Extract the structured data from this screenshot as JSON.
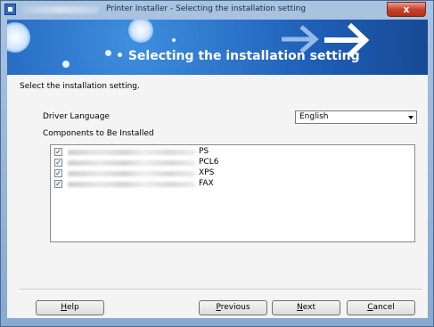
{
  "window": {
    "title": "Printer Installer - Selecting the installation setting",
    "close_glyph": "x"
  },
  "banner": {
    "title": "Selecting the installation setting"
  },
  "instruction": "Select the installation setting.",
  "driver_language": {
    "label": "Driver Language",
    "selected": "English"
  },
  "components": {
    "label": "Components to Be Installed",
    "items": [
      {
        "name": "PS",
        "checked": true
      },
      {
        "name": "PCL6",
        "checked": true
      },
      {
        "name": "XPS",
        "checked": true
      },
      {
        "name": "FAX",
        "checked": true
      }
    ]
  },
  "buttons": {
    "help": {
      "mnemonic": "H",
      "rest": "elp"
    },
    "previous": {
      "mnemonic": "P",
      "rest": "revious"
    },
    "next": {
      "mnemonic": "N",
      "rest": "ext"
    },
    "cancel": {
      "mnemonic": "C",
      "rest": "ancel"
    }
  },
  "icons": {
    "app": "printer-installer-icon",
    "check": "✓"
  },
  "colors": {
    "banner": "#1f5fb8",
    "close": "#c7422d"
  }
}
